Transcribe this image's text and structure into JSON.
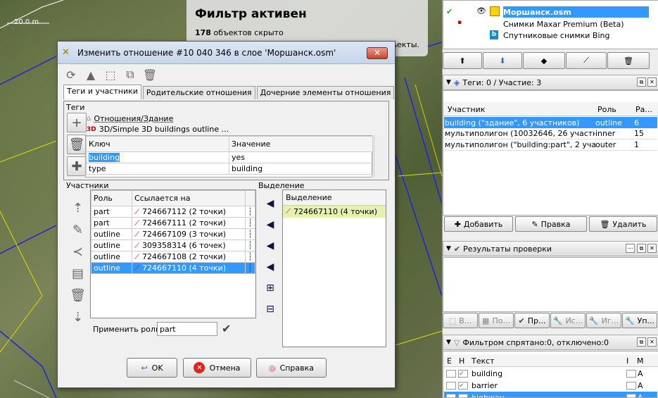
{
  "map": {
    "scale_label": "20.0 m",
    "filter_title": "Фильтр активен",
    "hidden_count": "178",
    "hidden_text": "объектов скрыто",
    "hidden_suffix": "бъекты."
  },
  "dialog": {
    "title": "Изменить отношение #10 040 346 в слое 'Моршанск.osm'",
    "tabs": [
      "Теги и участники",
      "Родительские отношения",
      "Дочерние элементы отношения"
    ],
    "tags_label": "Теги",
    "preset_1": "Отношения/Здание",
    "preset_2": "3D/Simple 3D buildings outline ...",
    "tag_headers": {
      "key": "Ключ",
      "value": "Значение"
    },
    "tags": [
      {
        "key": "building",
        "value": "yes"
      },
      {
        "key": "type",
        "value": "building"
      }
    ],
    "members_label": "Участники",
    "member_headers": {
      "role": "Роль",
      "ref": "Ссылается на"
    },
    "members": [
      {
        "role": "part",
        "ref": "724667112 (2 точки)"
      },
      {
        "role": "part",
        "ref": "724667111 (2 точки)"
      },
      {
        "role": "outline",
        "ref": "724667109 (3 точки)"
      },
      {
        "role": "outline",
        "ref": "309358314 (6 точек)"
      },
      {
        "role": "outline",
        "ref": "724667108 (2 точки)"
      },
      {
        "role": "outline",
        "ref": "724667110 (4 точки)"
      }
    ],
    "apply_role_label": "Применить роль:",
    "apply_role_value": "part",
    "selection_label": "Выделение",
    "selection_header": "Выделение",
    "selection_items": [
      "724667110 (4 точки)"
    ],
    "ok": "OK",
    "cancel": "Отмена",
    "help": "Справка"
  },
  "layers": {
    "items": [
      {
        "name": "Моршанск.osm",
        "active": true
      },
      {
        "name": "Снимки Maxar Premium (Beta)",
        "active": false
      },
      {
        "name": "Спутниковые снимки Bing",
        "active": false
      }
    ]
  },
  "tags_panel": {
    "title": "Теги: 0 / Участие: 3",
    "headers": {
      "member": "Участник",
      "role": "Роль",
      "pos": "Ра..."
    },
    "rows": [
      {
        "member": "building (\"здание\", 6 участников)",
        "role": "outline",
        "pos": "6"
      },
      {
        "member": "мультиполигон (10032646, 26 участни...",
        "role": "inner",
        "pos": "15"
      },
      {
        "member": "мультиполигон (\"building:part\", 2 участ...",
        "role": "outer",
        "pos": "1"
      }
    ],
    "add": "Добавить",
    "edit": "Правка",
    "delete": "Удалить"
  },
  "validation": {
    "title": "Результаты проверки",
    "buttons": [
      "В...",
      "По...",
      "Пр...",
      "Ис...",
      "Иг...",
      "Уп..."
    ]
  },
  "filters": {
    "title": "Фильтром спрятано:0, отключено:0",
    "headers": {
      "e": "E",
      "h": "H",
      "text": "Текст",
      "i": "I",
      "m": "M"
    },
    "rows": [
      {
        "text": "building",
        "m": "A"
      },
      {
        "text": "barrier",
        "m": "A"
      },
      {
        "text": "highway",
        "m": "A"
      }
    ]
  }
}
